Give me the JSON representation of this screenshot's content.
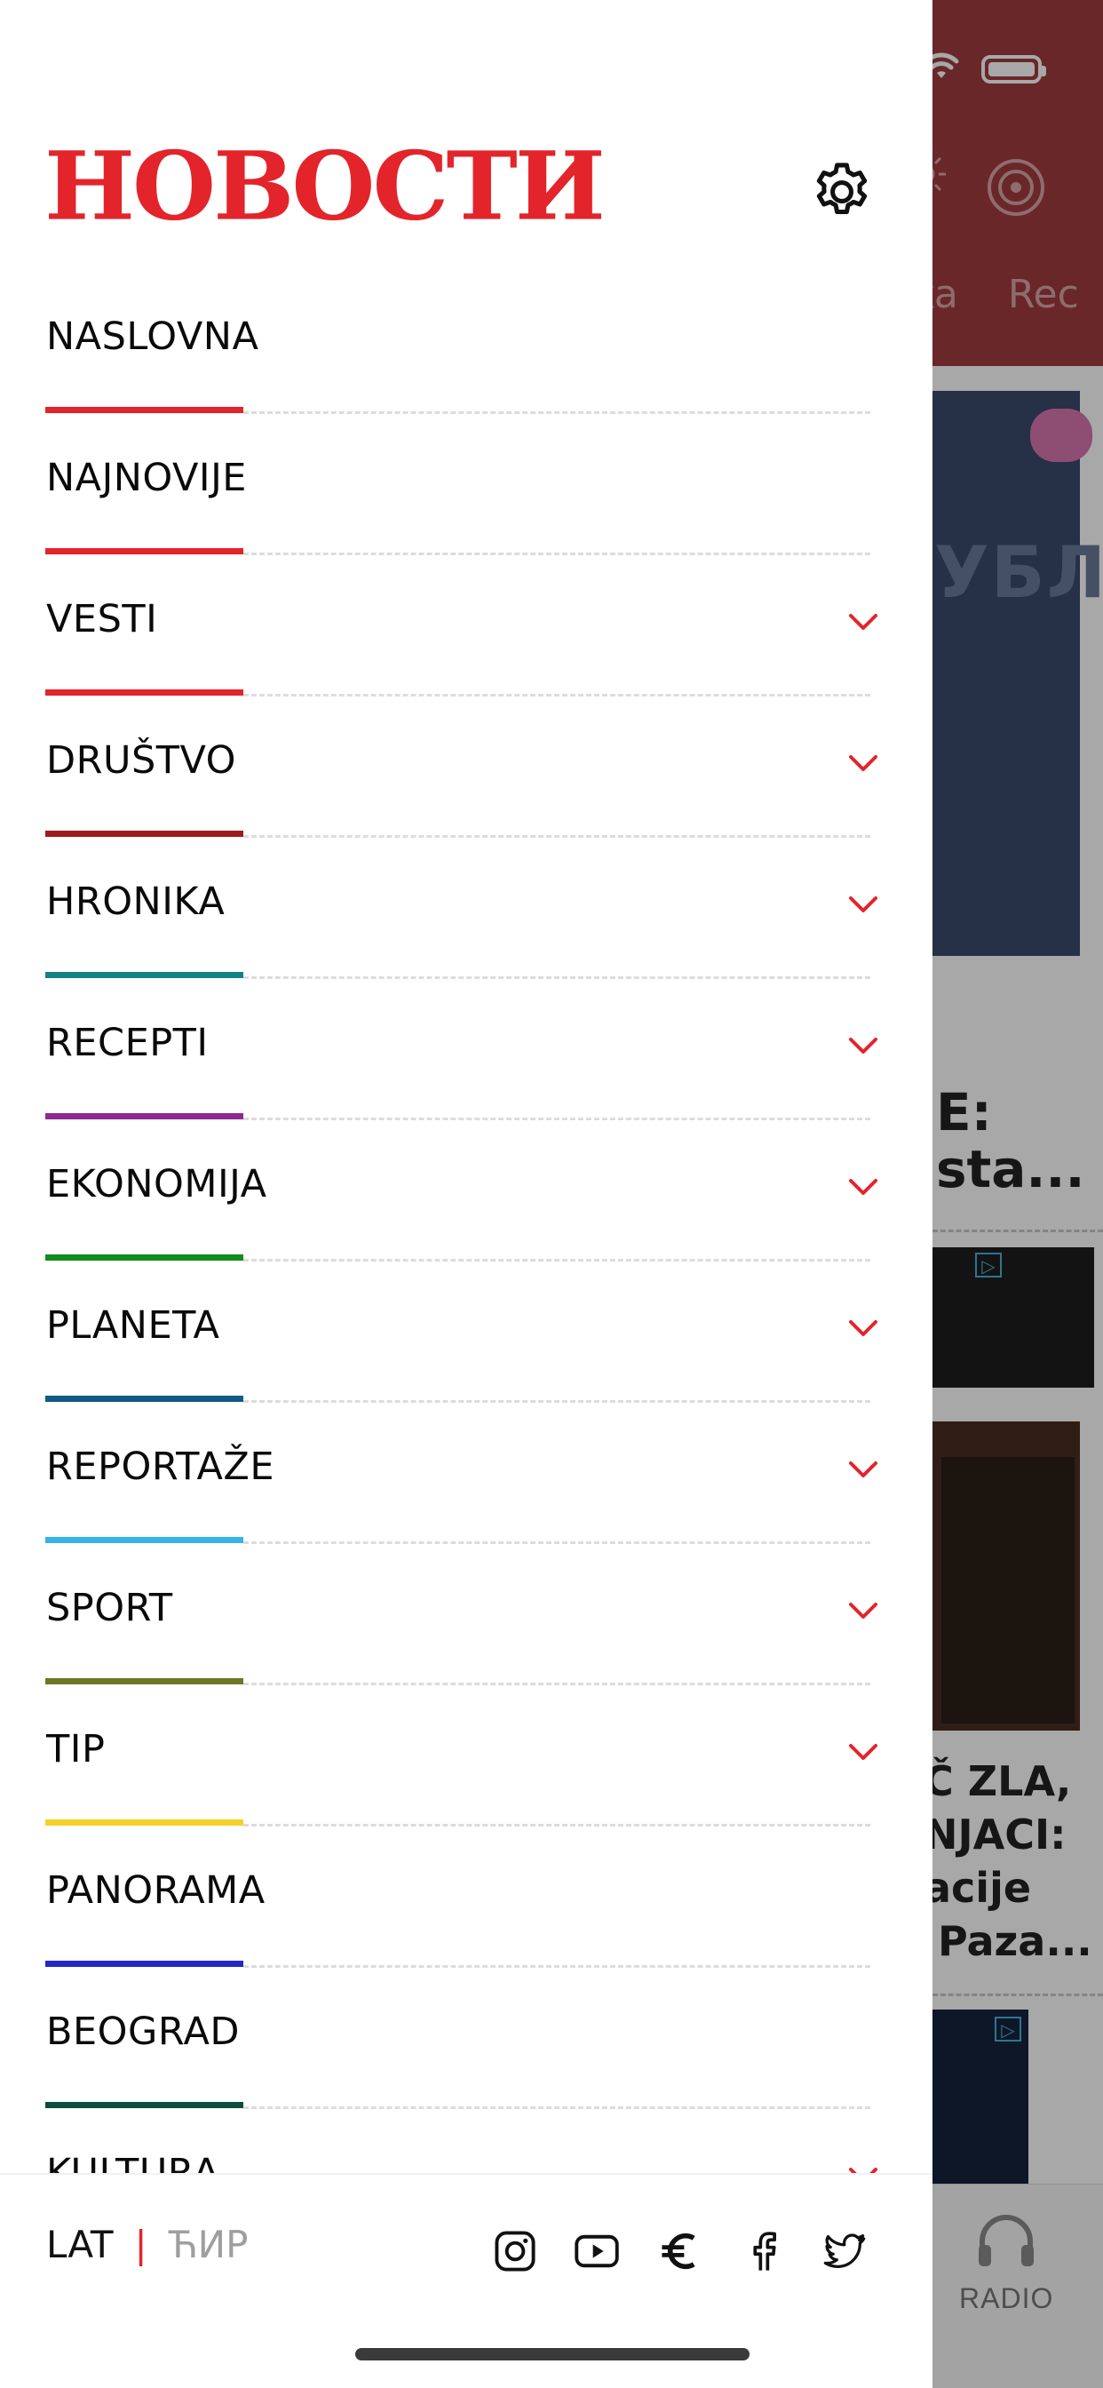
{
  "app": {
    "logo": "НОВОСТИ"
  },
  "status_bar": {
    "wifi_icon": "wifi-icon",
    "battery_icon": "battery-icon"
  },
  "header": {
    "settings_icon": "gear-icon"
  },
  "menu": {
    "items": [
      {
        "label": "NASLOVNA",
        "accent": "#e3242b",
        "expandable": false
      },
      {
        "label": "NAJNOVIJE",
        "accent": "#e3242b",
        "expandable": false
      },
      {
        "label": "VESTI",
        "accent": "#e3242b",
        "expandable": true
      },
      {
        "label": "DRUŠTVO",
        "accent": "#9e1b1b",
        "expandable": true
      },
      {
        "label": "HRONIKA",
        "accent": "#128382",
        "expandable": true
      },
      {
        "label": "RECEPTI",
        "accent": "#8f2a92",
        "expandable": true
      },
      {
        "label": "EKONOMIJA",
        "accent": "#128a1f",
        "expandable": true
      },
      {
        "label": "PLANETA",
        "accent": "#145a82",
        "expandable": true
      },
      {
        "label": "REPORTAŽE",
        "accent": "#37b4e6",
        "expandable": true
      },
      {
        "label": "SPORT",
        "accent": "#6d7726",
        "expandable": true
      },
      {
        "label": "TIP",
        "accent": "#f5d02c",
        "expandable": true
      },
      {
        "label": "PANORAMA",
        "accent": "#2528c9",
        "expandable": false
      },
      {
        "label": "BEOGRAD",
        "accent": "#0d4b3c",
        "expandable": false
      },
      {
        "label": "KULTURA",
        "accent": "#e3242b",
        "expandable": true
      }
    ],
    "chevron_color": "#e3242b"
  },
  "footer": {
    "lang_lat": "LAT",
    "lang_sep": "|",
    "lang_cyr": "ЋИР",
    "social": [
      "instagram-icon",
      "youtube-icon",
      "euro-icon",
      "facebook-icon",
      "twitter-icon"
    ]
  },
  "background_app": {
    "tabs": [
      "ika",
      "Rec"
    ],
    "headline_1": [
      "E:",
      "sta..."
    ],
    "card_1_text": "УБЛ",
    "headline_2": [
      "Č ZLA,",
      "NJACI:",
      "acije",
      " Paza..."
    ],
    "tabbar_radio_label": "RADIO"
  },
  "colors": {
    "brand_red": "#e3242b",
    "header_red": "#a23c3f"
  }
}
